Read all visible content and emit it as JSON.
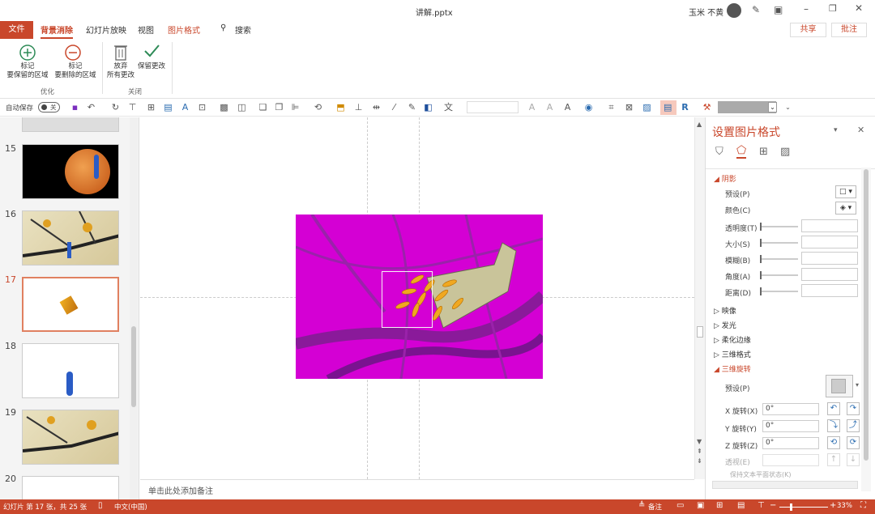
{
  "window": {
    "filename": "讲解.pptx",
    "user_name": "玉米 不黄"
  },
  "tabs": [
    "文件",
    "背景消除",
    "幻灯片放映",
    "视图",
    "图片格式"
  ],
  "search_label": "搜索",
  "share_label": "共享",
  "comment_label": "批注",
  "ribbon": {
    "optimize": {
      "mark_keep": "标记\n要保留的区域",
      "mark_remove": "标记\n要删除的区域",
      "group_label": "优化"
    },
    "close": {
      "discard": "放弃\n所有更改",
      "keep": "保留更改",
      "group_label": "关闭"
    }
  },
  "qat": {
    "autosave_label": "自动保存",
    "toggle_state": "关"
  },
  "slides": [
    {
      "num": "15"
    },
    {
      "num": "16"
    },
    {
      "num": "17"
    },
    {
      "num": "18"
    },
    {
      "num": "19"
    },
    {
      "num": "20"
    }
  ],
  "notes_placeholder": "单击此处添加备注",
  "pane": {
    "title": "设置图片格式",
    "shadow": {
      "label": "阴影",
      "preset": "预设(P)",
      "color": "颜色(C)",
      "transparency": "透明度(T)",
      "size": "大小(S)",
      "blur": "模糊(B)",
      "angle": "角度(A)",
      "distance": "距离(D)"
    },
    "sections": [
      "映像",
      "发光",
      "柔化边缘",
      "三维格式"
    ],
    "rotation": {
      "label": "三维旋转",
      "preset": "预设(P)",
      "x_label": "X 旋转(X)",
      "x_value": "0°",
      "y_label": "Y 旋转(Y)",
      "y_value": "0°",
      "z_label": "Z 旋转(Z)",
      "z_value": "0°",
      "perspective": "透视(E)",
      "keep_flat": "保持文本平面状态(K)"
    }
  },
  "status": {
    "slide_info": "幻灯片 第 17 张，共 25 张",
    "language": "中文(中国)",
    "notes": "备注",
    "zoom": "33%"
  },
  "colors": {
    "accent": "#c9472b",
    "magenta": "#d400d4"
  }
}
